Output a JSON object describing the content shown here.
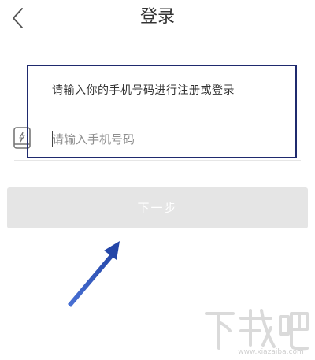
{
  "header": {
    "title": "登录",
    "back_icon": "chevron-left-icon"
  },
  "form": {
    "prompt": "请输入你的手机号码进行注册或登录",
    "phone_placeholder": "请输入手机号码",
    "phone_value": "",
    "phone_icon": "phone-icon"
  },
  "actions": {
    "next_label": "下一步"
  },
  "annotations": {
    "highlight_color": "#1f2a6e",
    "arrow_color": "#2f55c0"
  },
  "watermark": {
    "text": "下载吧",
    "url": "www.xiazaiba.com"
  },
  "colors": {
    "button_disabled_bg": "#e5e5e5",
    "text_primary": "#333333",
    "placeholder": "#8e8e8e"
  }
}
